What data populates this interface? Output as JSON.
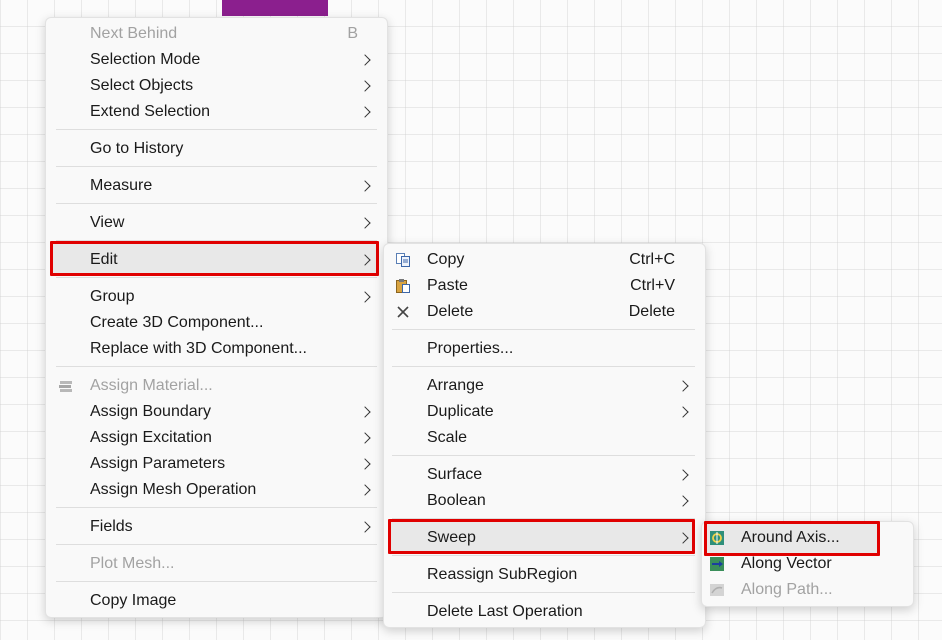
{
  "main_menu": {
    "items": [
      {
        "label": "Next Behind",
        "shortcut": "B"
      },
      {
        "label": "Selection Mode"
      },
      {
        "label": "Select Objects"
      },
      {
        "label": "Extend Selection"
      },
      {
        "label": "Go to History"
      },
      {
        "label": "Measure"
      },
      {
        "label": "View"
      },
      {
        "label": "Edit"
      },
      {
        "label": "Group"
      },
      {
        "label": "Create 3D Component..."
      },
      {
        "label": "Replace with 3D Component..."
      },
      {
        "label": "Assign Material..."
      },
      {
        "label": "Assign Boundary"
      },
      {
        "label": "Assign Excitation"
      },
      {
        "label": "Assign Parameters"
      },
      {
        "label": "Assign Mesh Operation"
      },
      {
        "label": "Fields"
      },
      {
        "label": "Plot Mesh..."
      },
      {
        "label": "Copy Image"
      }
    ]
  },
  "edit_submenu": {
    "items": [
      {
        "label": "Copy",
        "shortcut": "Ctrl+C"
      },
      {
        "label": "Paste",
        "shortcut": "Ctrl+V"
      },
      {
        "label": "Delete",
        "shortcut": "Delete"
      },
      {
        "label": "Properties..."
      },
      {
        "label": "Arrange"
      },
      {
        "label": "Duplicate"
      },
      {
        "label": "Scale"
      },
      {
        "label": "Surface"
      },
      {
        "label": "Boolean"
      },
      {
        "label": "Sweep"
      },
      {
        "label": "Reassign SubRegion"
      },
      {
        "label": "Delete Last Operation"
      }
    ]
  },
  "sweep_submenu": {
    "items": [
      {
        "label": "Around Axis..."
      },
      {
        "label": "Along Vector"
      },
      {
        "label": "Along Path..."
      }
    ]
  },
  "colors": {
    "highlight_border": "#e00000",
    "menu_background": "#f9f9f9",
    "disabled_text": "#a2a2a2",
    "accent_block": "#8b1f8e"
  }
}
